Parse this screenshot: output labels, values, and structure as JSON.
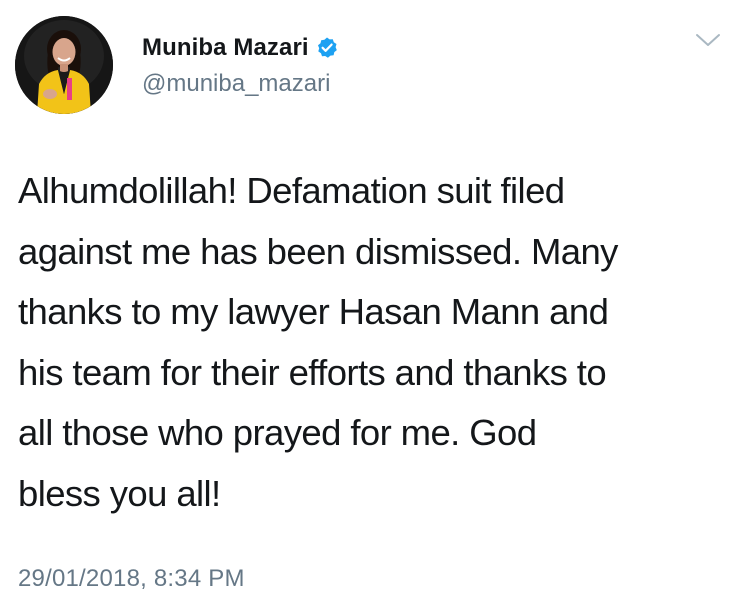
{
  "author": {
    "display_name": "Muniba Mazari",
    "handle": "@muniba_mazari",
    "verified": true
  },
  "tweet": {
    "text": "Alhumdolillah! Defamation suit filed\nagainst me has been dismissed. Many\nthanks to my lawyer Hasan Mann and\nhis team for their efforts and thanks to\nall those who prayed for me. God\nbless you all!",
    "timestamp": "29/01/2018, 8:34 PM"
  },
  "icons": {
    "verified": "verified-badge-icon",
    "menu": "chevron-down-icon"
  },
  "colors": {
    "verified_blue": "#1da1f2",
    "secondary_text": "#657786",
    "primary_text": "#14171a",
    "avatar_jacket": "#f2c318"
  }
}
